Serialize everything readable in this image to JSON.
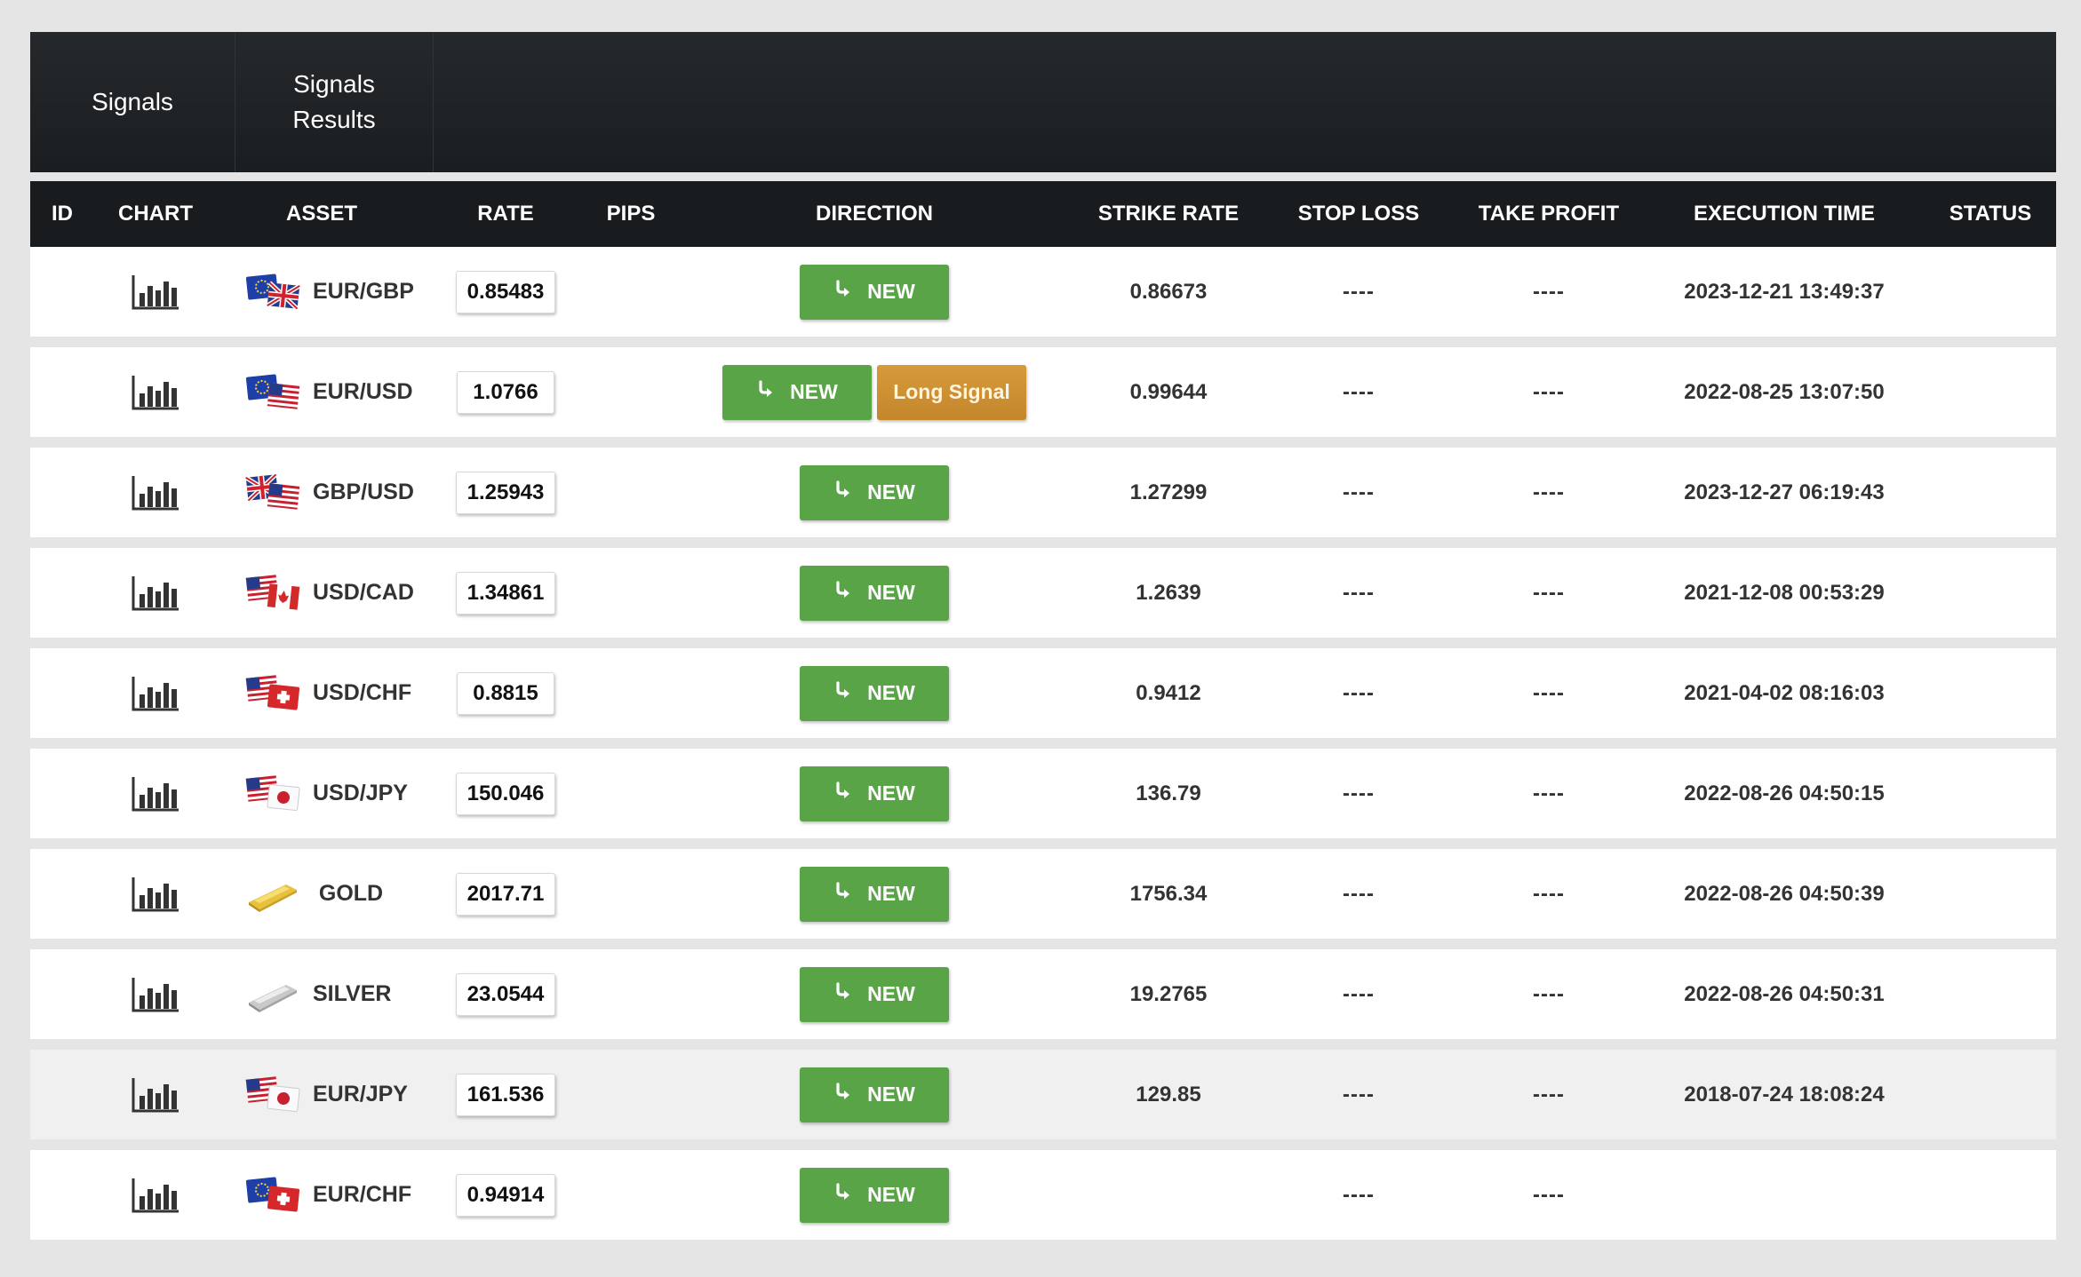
{
  "tabs": [
    {
      "label": "Signals"
    },
    {
      "label": "Signals\nResults"
    }
  ],
  "columns": [
    "ID",
    "CHART",
    "ASSET",
    "RATE",
    "PIPS",
    "DIRECTION",
    "STRIKE RATE",
    "STOP LOSS",
    "TAKE PROFIT",
    "EXECUTION TIME",
    "STATUS"
  ],
  "new_label": "NEW",
  "long_signal_label": "Long Signal",
  "rows": [
    {
      "asset": "EUR/GBP",
      "flag": "eur-gbp-flag-icon",
      "rate": "0.85483",
      "strike": "0.86673",
      "stop": "----",
      "tp": "----",
      "exec": "2023-12-21 13:49:37"
    },
    {
      "asset": "EUR/USD",
      "flag": "eur-usd-flag-icon",
      "rate": "1.0766",
      "strike": "0.99644",
      "stop": "----",
      "tp": "----",
      "exec": "2022-08-25 13:07:50",
      "long": true
    },
    {
      "asset": "GBP/USD",
      "flag": "gbp-usd-flag-icon",
      "rate": "1.25943",
      "strike": "1.27299",
      "stop": "----",
      "tp": "----",
      "exec": "2023-12-27 06:19:43"
    },
    {
      "asset": "USD/CAD",
      "flag": "usd-cad-flag-icon",
      "rate": "1.34861",
      "strike": "1.2639",
      "stop": "----",
      "tp": "----",
      "exec": "2021-12-08 00:53:29"
    },
    {
      "asset": "USD/CHF",
      "flag": "usd-chf-flag-icon",
      "rate": "0.8815",
      "strike": "0.9412",
      "stop": "----",
      "tp": "----",
      "exec": "2021-04-02 08:16:03"
    },
    {
      "asset": "USD/JPY",
      "flag": "usd-jpy-flag-icon",
      "rate": "150.046",
      "strike": "136.79",
      "stop": "----",
      "tp": "----",
      "exec": "2022-08-26 04:50:15"
    },
    {
      "asset": "GOLD",
      "flag": "gold-bar-icon",
      "rate": "2017.71",
      "strike": "1756.34",
      "stop": "----",
      "tp": "----",
      "exec": "2022-08-26 04:50:39"
    },
    {
      "asset": "SILVER",
      "flag": "silver-bar-icon",
      "rate": "23.0544",
      "strike": "19.2765",
      "stop": "----",
      "tp": "----",
      "exec": "2022-08-26 04:50:31"
    },
    {
      "asset": "EUR/JPY",
      "flag": "eur-jpy-flag-icon",
      "rate": "161.536",
      "strike": "129.85",
      "stop": "----",
      "tp": "----",
      "exec": "2018-07-24 18:08:24"
    },
    {
      "asset": "EUR/CHF",
      "flag": "eur-chf-flag-icon",
      "rate": "0.94914",
      "strike": "",
      "stop": "----",
      "tp": "----",
      "exec": ""
    }
  ],
  "colors": {
    "header_bg": "#181c1e",
    "new_button": "#5aa448",
    "long_signal_button": "#d08f33",
    "page_bg": "#e5e5e5"
  }
}
